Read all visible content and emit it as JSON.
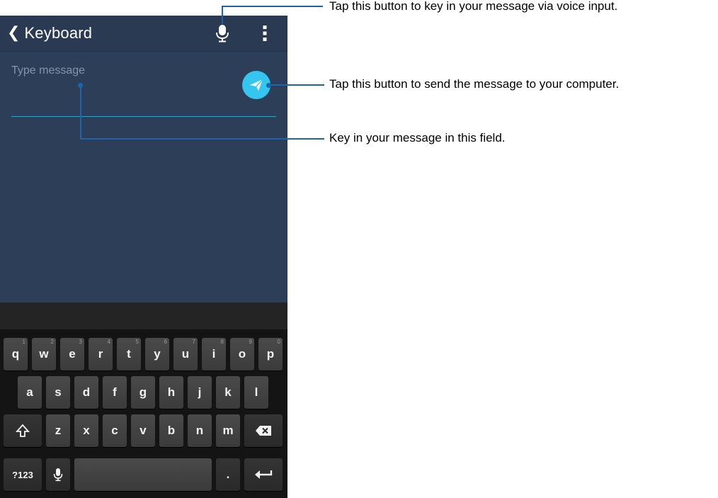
{
  "app_bar": {
    "title": "Keyboard",
    "back_icon": "chevron-left-icon",
    "mic_icon": "microphone-icon",
    "overflow_icon": "more-vertical-icon"
  },
  "message": {
    "placeholder": "Type message",
    "value": "",
    "send_icon": "send-icon"
  },
  "keyboard": {
    "row1": [
      {
        "label": "q",
        "hint": "1"
      },
      {
        "label": "w",
        "hint": "2"
      },
      {
        "label": "e",
        "hint": "3"
      },
      {
        "label": "r",
        "hint": "4"
      },
      {
        "label": "t",
        "hint": "5"
      },
      {
        "label": "y",
        "hint": "6"
      },
      {
        "label": "u",
        "hint": "7"
      },
      {
        "label": "i",
        "hint": "8"
      },
      {
        "label": "o",
        "hint": "9"
      },
      {
        "label": "p",
        "hint": "0"
      }
    ],
    "row2": [
      "a",
      "s",
      "d",
      "f",
      "g",
      "h",
      "j",
      "k",
      "l"
    ],
    "row3": [
      "z",
      "x",
      "c",
      "v",
      "b",
      "n",
      "m"
    ],
    "shift_icon": "shift-icon",
    "backspace_icon": "backspace-icon",
    "symbols_label": "?123",
    "voice_icon": "microphone-icon",
    "space_label": "",
    "period_label": ".",
    "enter_icon": "enter-icon"
  },
  "callouts": {
    "voice": "Tap this button to key in your message via voice input.",
    "send": "Tap this button to send the message to your computer.",
    "field": "Key in your message in this field."
  },
  "colors": {
    "screen_bg": "#2d3f58",
    "app_bar_bg": "#2a3a52",
    "send_button": "#35c6ef",
    "callout_line": "#1f64a8",
    "keyboard_bg": "#141414"
  }
}
